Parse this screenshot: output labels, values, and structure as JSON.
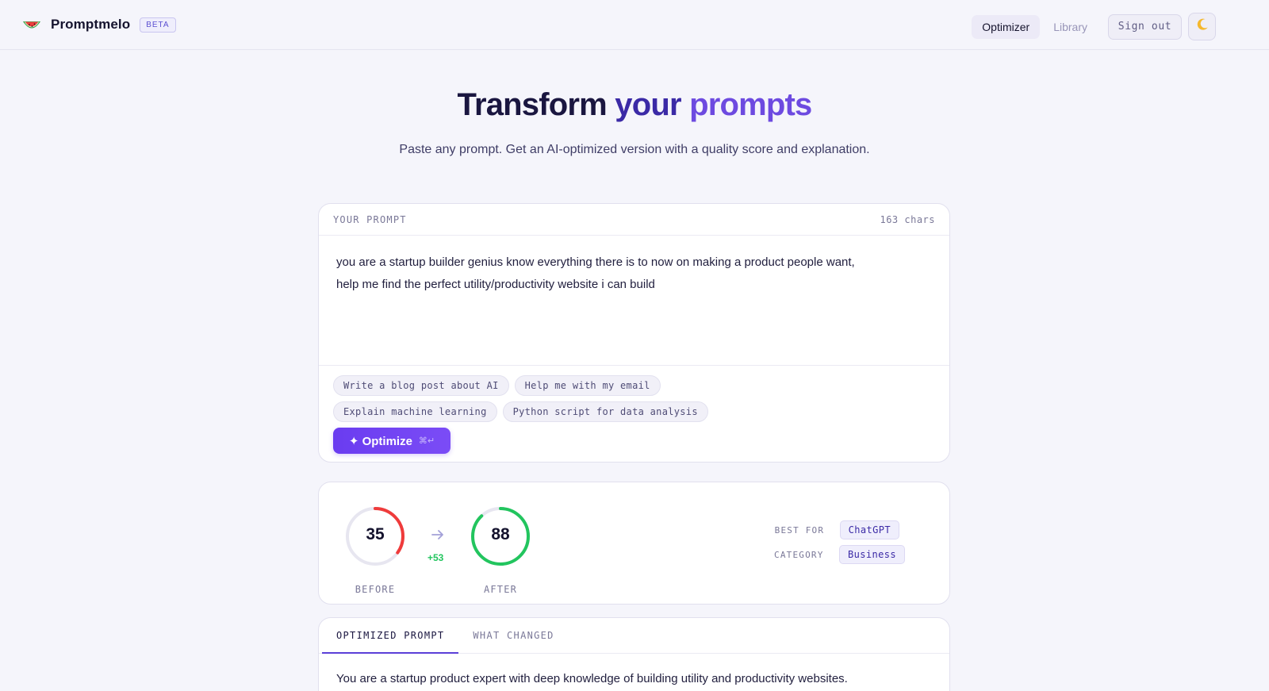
{
  "header": {
    "brand_name": "Promptmelo",
    "badge": "BETA",
    "nav": [
      {
        "label": "Optimizer",
        "active": true
      },
      {
        "label": "Library",
        "active": false
      }
    ],
    "sign_out_label": "Sign out",
    "theme_icon": "moon-icon"
  },
  "hero": {
    "title_part1": "Transform",
    "title_part2": "your",
    "title_part3": "prompts",
    "subtitle": "Paste any prompt. Get an AI-optimized version with a quality score and explanation."
  },
  "prompt_card": {
    "label": "YOUR PROMPT",
    "char_count": "163 chars",
    "text_line1": "you are a startup builder genius know everything there is to now on making a product people want,",
    "text_line2": "help me find the perfect utility/productivity website i can build",
    "suggestions": [
      "Write a blog post about AI",
      "Help me with my email",
      "Explain machine learning",
      "Python script for data analysis"
    ],
    "optimize_label": "✦ Optimize",
    "optimize_shortcut": "⌘↵"
  },
  "scores": {
    "before": {
      "value": 35,
      "label": "BEFORE",
      "color": "#ef3b3b"
    },
    "after": {
      "value": 88,
      "label": "AFTER",
      "color": "#22c55e"
    },
    "delta": "+53",
    "best_for_label": "BEST FOR",
    "best_for_value": "ChatGPT",
    "category_label": "CATEGORY",
    "category_value": "Business"
  },
  "result_card": {
    "tabs": [
      {
        "label": "OPTIMIZED PROMPT",
        "active": true
      },
      {
        "label": "WHAT CHANGED",
        "active": false
      }
    ],
    "text": "You are a startup product expert with deep knowledge of building utility and productivity websites."
  },
  "colors": {
    "accent": "#6a3cf0",
    "background": "#f5f5fb"
  }
}
